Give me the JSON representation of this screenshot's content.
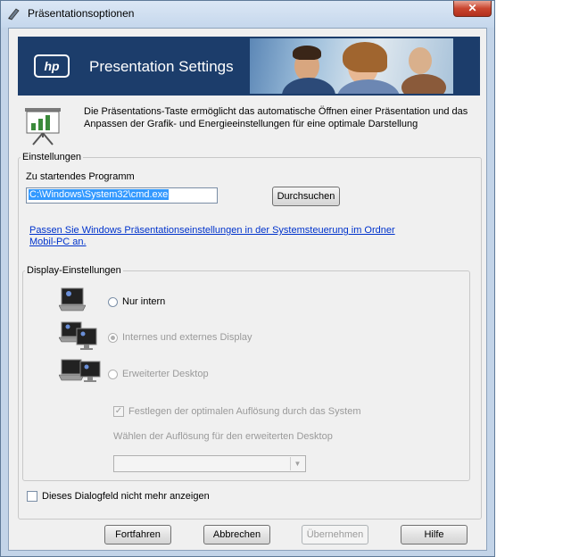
{
  "window": {
    "title": "Präsentationsoptionen",
    "close_glyph": "✕"
  },
  "banner": {
    "logo_text": "hp",
    "title": "Presentation Settings"
  },
  "intro": {
    "text": "Die Präsentations-Taste ermöglicht das automatische Öffnen einer Präsentation und das Anpassen der Grafik- und Energieeinstellungen für eine optimale Darstellung",
    "icon": "projector-screen-icon"
  },
  "settings": {
    "legend": "Einstellungen",
    "program_label": "Zu startendes Programm",
    "program_value": "C:\\Windows\\System32\\cmd.exe",
    "browse_label": "Durchsuchen",
    "link_text": "Passen Sie Windows Präsentationseinstellungen in der Systemsteuerung im Ordner Mobil-PC an."
  },
  "display": {
    "legend": "Display-Einstellungen",
    "options": [
      {
        "label": "Nur intern",
        "icon": "laptop-icon",
        "enabled": true,
        "selected": false
      },
      {
        "label": "Internes und externes Display",
        "icon": "laptop-monitor-clone-icon",
        "enabled": false,
        "selected": true
      },
      {
        "label": "Erweiterter Desktop",
        "icon": "laptop-monitor-extend-icon",
        "enabled": false,
        "selected": false
      }
    ],
    "optimal_label": "Festlegen der optimalen Auflösung durch das System",
    "optimal_checked": true,
    "resolution_label": "Wählen der Auflösung für den erweiterten Desktop",
    "resolution_value": ""
  },
  "dont_show_label": "Dieses Dialogfeld nicht mehr anzeigen",
  "buttons": {
    "continue": "Fortfahren",
    "cancel": "Abbrechen",
    "apply": "Übernehmen",
    "help": "Hilfe"
  }
}
